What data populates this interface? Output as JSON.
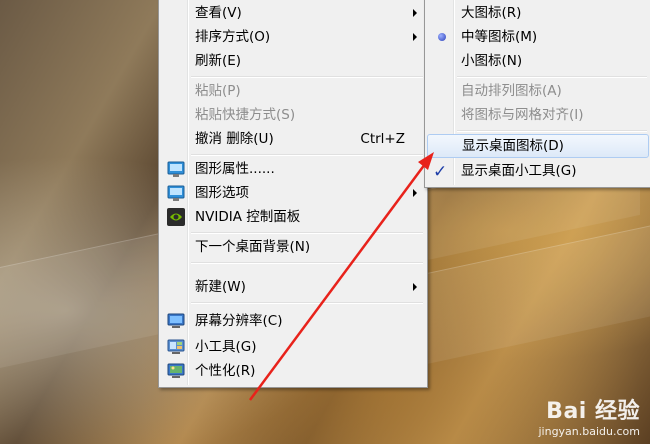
{
  "context_menu": {
    "items": [
      {
        "label": "查看(V)",
        "submenu": true
      },
      {
        "label": "排序方式(O)",
        "submenu": true
      },
      {
        "label": "刷新(E)"
      },
      {
        "label": "粘贴(P)",
        "disabled": true
      },
      {
        "label": "粘贴快捷方式(S)",
        "disabled": true
      },
      {
        "label": "撤消 删除(U)",
        "shortcut": "Ctrl+Z"
      },
      {
        "label": "图形属性......",
        "icon": "graphics-properties-icon"
      },
      {
        "label": "图形选项",
        "icon": "graphics-options-icon",
        "submenu": true
      },
      {
        "label": "NVIDIA 控制面板",
        "icon": "nvidia-icon"
      },
      {
        "label": "下一个桌面背景(N)"
      },
      {
        "label": "新建(W)",
        "submenu": true
      },
      {
        "label": "屏幕分辨率(C)",
        "icon": "screen-resolution-icon"
      },
      {
        "label": "小工具(G)",
        "icon": "gadgets-icon"
      },
      {
        "label": "个性化(R)",
        "icon": "personalize-icon"
      }
    ]
  },
  "view_submenu": {
    "items": [
      {
        "label": "大图标(R)"
      },
      {
        "label": "中等图标(M)",
        "selected": true
      },
      {
        "label": "小图标(N)"
      },
      {
        "label": "自动排列图标(A)",
        "disabled": true
      },
      {
        "label": "将图标与网格对齐(I)",
        "disabled": true
      },
      {
        "label": "显示桌面图标(D)",
        "highlighted": true
      },
      {
        "label": "显示桌面小工具(G)",
        "checked": true
      }
    ]
  },
  "watermark": {
    "logo": "Bai 经验",
    "url": "jingyan.baidu.com"
  },
  "colors": {
    "annotation_arrow": "#e8221b",
    "highlight_border": "#aeccf2"
  }
}
